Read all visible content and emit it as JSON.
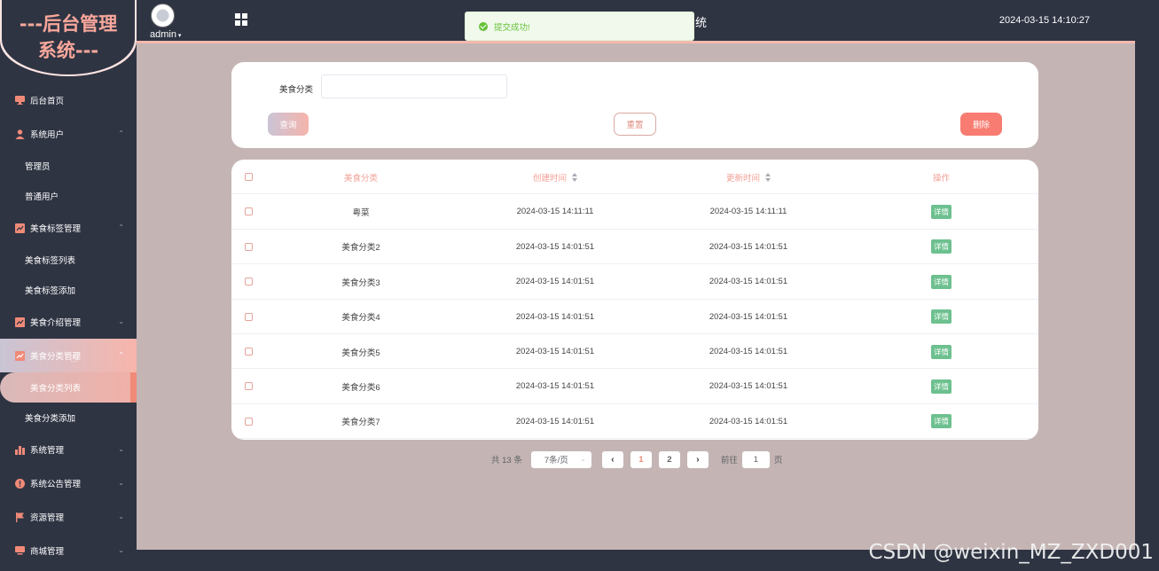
{
  "sidebar": {
    "logo": "---后台管理系统---",
    "menu": [
      {
        "label": "后台首页",
        "icon": "monitor-icon",
        "chevron": ""
      },
      {
        "label": "系统用户",
        "icon": "user-icon",
        "chevron": "⌃"
      },
      {
        "label": "管理员",
        "sub": true
      },
      {
        "label": "普通用户",
        "sub": true
      },
      {
        "label": "美食标签管理",
        "icon": "chart-icon",
        "chevron": "⌃"
      },
      {
        "label": "美食标签列表",
        "sub": true
      },
      {
        "label": "美食标签添加",
        "sub": true
      },
      {
        "label": "美食介绍管理",
        "icon": "chart-icon",
        "chevron": "⌄"
      },
      {
        "label": "美食分类管理",
        "icon": "chart-icon",
        "chevron": "⌃",
        "active": true
      },
      {
        "label": "美食分类列表",
        "sub": true,
        "active": true
      },
      {
        "label": "美食分类添加",
        "sub": true
      },
      {
        "label": "系统管理",
        "icon": "bar-chart-icon",
        "chevron": "⌄"
      },
      {
        "label": "系统公告管理",
        "icon": "info-icon",
        "chevron": "⌄"
      },
      {
        "label": "资源管理",
        "icon": "flag-icon",
        "chevron": "⌄"
      },
      {
        "label": "商城管理",
        "icon": "monitor-icon",
        "chevron": "⌄"
      }
    ]
  },
  "header": {
    "user": "admin",
    "title_fragment": "统",
    "datetime": "2024-03-15 14:10:27"
  },
  "toast": {
    "message": "提交成功!",
    "color": "#67c23a"
  },
  "search": {
    "label": "美食分类",
    "value": "",
    "query_label": "查询",
    "reset_label": "重置",
    "delete_label": "删除"
  },
  "table": {
    "columns": [
      "美食分类",
      "创建时间",
      "更新时间",
      "操作"
    ],
    "detail_label": "详情",
    "rows": [
      {
        "category": "粤菜",
        "created": "2024-03-15 14:11:11",
        "updated": "2024-03-15 14:11:11"
      },
      {
        "category": "美食分类2",
        "created": "2024-03-15 14:01:51",
        "updated": "2024-03-15 14:01:51"
      },
      {
        "category": "美食分类3",
        "created": "2024-03-15 14:01:51",
        "updated": "2024-03-15 14:01:51"
      },
      {
        "category": "美食分类4",
        "created": "2024-03-15 14:01:51",
        "updated": "2024-03-15 14:01:51"
      },
      {
        "category": "美食分类5",
        "created": "2024-03-15 14:01:51",
        "updated": "2024-03-15 14:01:51"
      },
      {
        "category": "美食分类6",
        "created": "2024-03-15 14:01:51",
        "updated": "2024-03-15 14:01:51"
      },
      {
        "category": "美食分类7",
        "created": "2024-03-15 14:01:51",
        "updated": "2024-03-15 14:01:51"
      }
    ]
  },
  "pagination": {
    "total": "共 13 条",
    "page_size": "7条/页",
    "pages": [
      "1",
      "2"
    ],
    "current": "1",
    "goto_label": "前往",
    "goto_value": "1",
    "page_unit": "页"
  },
  "watermark": "CSDN @weixin_MZ_ZXD001",
  "colors": {
    "sidebar_bg": "#2f3443",
    "accent": "#f08a78",
    "main_bg": "#c4b5b4",
    "detail_tag": "#6dc08f",
    "delete_btn": "#f87c72"
  }
}
